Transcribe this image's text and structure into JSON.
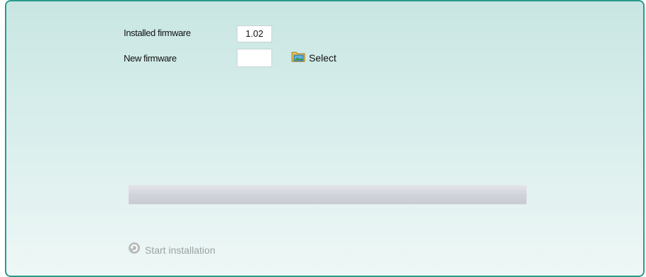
{
  "firmware": {
    "installed_label": "Installed firmware",
    "installed_value": "1.02",
    "new_label": "New firmware",
    "new_value": "",
    "select_label": "Select"
  },
  "progress": {
    "fraction": 0
  },
  "actions": {
    "start_label": "Start installation"
  },
  "colors": {
    "accent": "#2a9a8a",
    "disabled_text": "#9aa3a3"
  },
  "icons": {
    "select": "folder-image-icon",
    "start": "refresh-icon"
  }
}
